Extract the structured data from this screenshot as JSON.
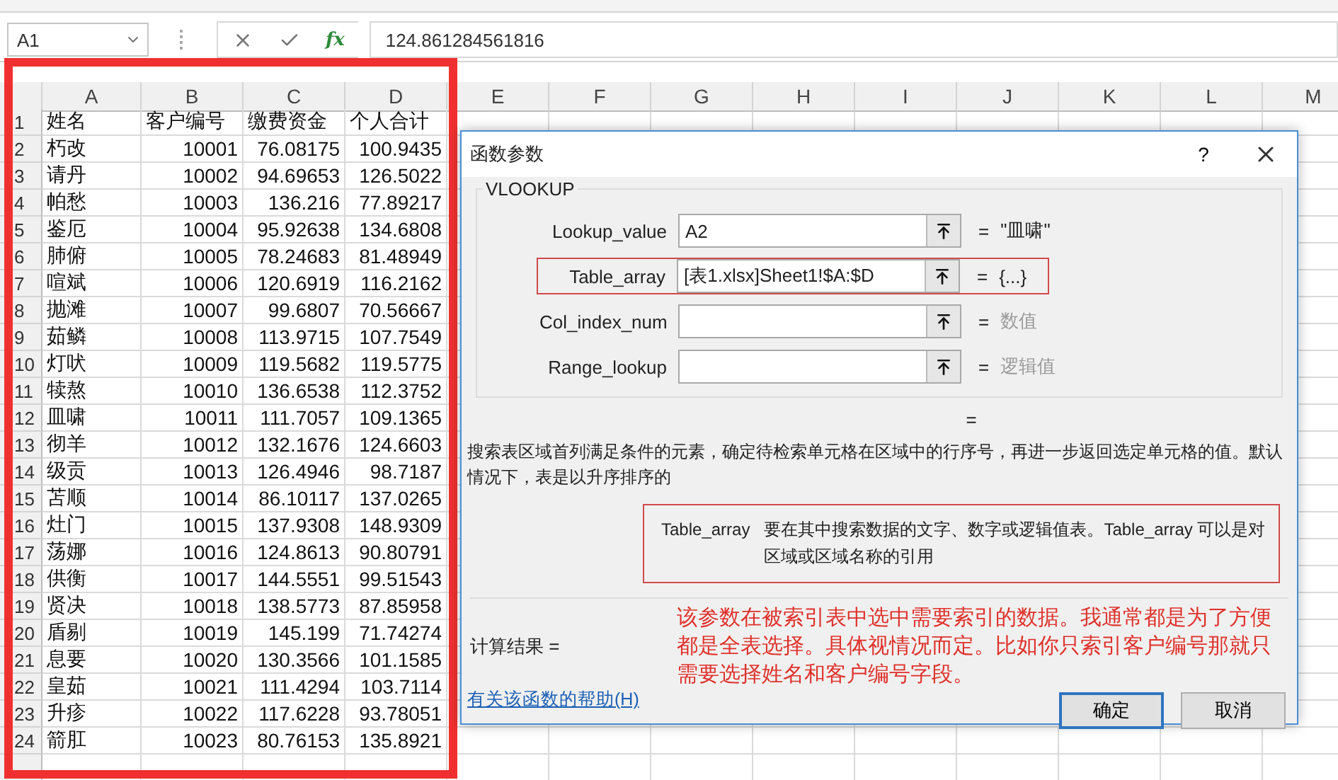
{
  "name_box": {
    "value": "A1"
  },
  "formula_bar": {
    "function_label": "fx",
    "value": "124.861284561816"
  },
  "columns": [
    "A",
    "B",
    "C",
    "D",
    "E",
    "F",
    "G",
    "H",
    "I",
    "J",
    "K",
    "L",
    "M"
  ],
  "rows": [
    {
      "number": "1",
      "cells": [
        "姓名",
        "客户编号",
        "缴费资金",
        "个人合计"
      ]
    },
    {
      "number": "2",
      "cells": [
        "朽改",
        "10001",
        "76.08175",
        "100.9435"
      ]
    },
    {
      "number": "3",
      "cells": [
        "请丹",
        "10002",
        "94.69653",
        "126.5022"
      ]
    },
    {
      "number": "4",
      "cells": [
        "帕愁",
        "10003",
        "136.216",
        "77.89217"
      ]
    },
    {
      "number": "5",
      "cells": [
        "鉴厄",
        "10004",
        "95.92638",
        "134.6808"
      ]
    },
    {
      "number": "6",
      "cells": [
        "肺俯",
        "10005",
        "78.24683",
        "81.48949"
      ]
    },
    {
      "number": "7",
      "cells": [
        "喧斌",
        "10006",
        "120.6919",
        "116.2162"
      ]
    },
    {
      "number": "8",
      "cells": [
        "抛滩",
        "10007",
        "99.6807",
        "70.56667"
      ]
    },
    {
      "number": "9",
      "cells": [
        "茹鳞",
        "10008",
        "113.9715",
        "107.7549"
      ]
    },
    {
      "number": "10",
      "cells": [
        "灯吠",
        "10009",
        "119.5682",
        "119.5775"
      ]
    },
    {
      "number": "11",
      "cells": [
        "犊熬",
        "10010",
        "136.6538",
        "112.3752"
      ]
    },
    {
      "number": "12",
      "cells": [
        "皿啸",
        "10011",
        "111.7057",
        "109.1365"
      ]
    },
    {
      "number": "13",
      "cells": [
        "彻羊",
        "10012",
        "132.1676",
        "124.6603"
      ]
    },
    {
      "number": "14",
      "cells": [
        "级贡",
        "10013",
        "126.4946",
        "98.7187"
      ]
    },
    {
      "number": "15",
      "cells": [
        "苫顺",
        "10014",
        "86.10117",
        "137.0265"
      ]
    },
    {
      "number": "16",
      "cells": [
        "灶门",
        "10015",
        "137.9308",
        "148.9309"
      ]
    },
    {
      "number": "17",
      "cells": [
        "荡娜",
        "10016",
        "124.8613",
        "90.80791"
      ]
    },
    {
      "number": "18",
      "cells": [
        "供衡",
        "10017",
        "144.5551",
        "99.51543"
      ]
    },
    {
      "number": "19",
      "cells": [
        "贤决",
        "10018",
        "138.5773",
        "87.85958"
      ]
    },
    {
      "number": "20",
      "cells": [
        "盾剔",
        "10019",
        "145.199",
        "71.74274"
      ]
    },
    {
      "number": "21",
      "cells": [
        "息要",
        "10020",
        "130.3566",
        "101.1585"
      ]
    },
    {
      "number": "22",
      "cells": [
        "皇茹",
        "10021",
        "111.4294",
        "103.7114"
      ]
    },
    {
      "number": "23",
      "cells": [
        "升疹",
        "10022",
        "117.6228",
        "93.78051"
      ]
    },
    {
      "number": "24",
      "cells": [
        "箭肛",
        "10023",
        "80.76153",
        "135.8921"
      ]
    }
  ],
  "dialog": {
    "title": "函数参数",
    "help_button": "?",
    "function_name": "VLOOKUP",
    "arguments": [
      {
        "label": "Lookup_value",
        "value": "A2",
        "operator": "=",
        "result": "\"皿啸\"",
        "kind": "value",
        "highlighted": false
      },
      {
        "label": "Table_array",
        "value": "[表1.xlsx]Sheet1!$A:$D",
        "operator": "=",
        "result": "{...}",
        "kind": "value",
        "highlighted": true
      },
      {
        "label": "Col_index_num",
        "operator": "=",
        "result": "数值",
        "kind": "hint",
        "highlighted": false
      },
      {
        "label": "Range_lookup",
        "operator": "=",
        "result": "逻辑值",
        "kind": "hint",
        "highlighted": false
      }
    ],
    "formula_result": "=",
    "description": "搜索表区域首列满足条件的元素，确定待检索单元格在区域中的行序号，再进一步返回选定单元格的值。默认情况下，表是以升序排序的",
    "argument_help": {
      "name": "Table_array",
      "text": "要在其中搜索数据的文字、数字或逻辑值表。Table_array 可以是对区域或区域名称的引用"
    },
    "annotation": "该参数在被索引表中选中需要索引的数据。我通常都是为了方便都是全表选择。具体视情况而定。比如你只索引客户编号那就只需要选择姓名和客户编号字段。",
    "calc_result": "计算结果 =",
    "help_link": "有关该函数的帮助(H)",
    "buttons": [
      {
        "label": "确定",
        "default": true
      },
      {
        "label": "取消",
        "default": false
      }
    ]
  }
}
